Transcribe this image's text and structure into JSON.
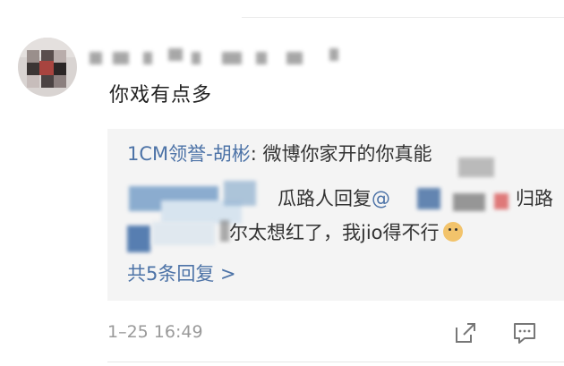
{
  "comment": {
    "text": "你戏有点多",
    "timestamp": "1–25 16:49"
  },
  "reply": {
    "first": {
      "author": "1CM领誉-胡彬",
      "separator": ": ",
      "text": "微博你家开的你真能"
    },
    "second": {
      "visible_a": "瓜路人回复",
      "mention": "@",
      "visible_b": "归路"
    },
    "third": {
      "text": "尔太想红了，我jio得不行"
    },
    "more_label": "共5条回复 >"
  },
  "icons": {
    "share": "share-icon",
    "comment": "comment-icon",
    "emoji": "doge-emoji-icon"
  },
  "colors": {
    "link": "#4d73a7",
    "text": "#222222",
    "muted": "#9a9a9a",
    "reply_bg": "#f4f4f4"
  }
}
